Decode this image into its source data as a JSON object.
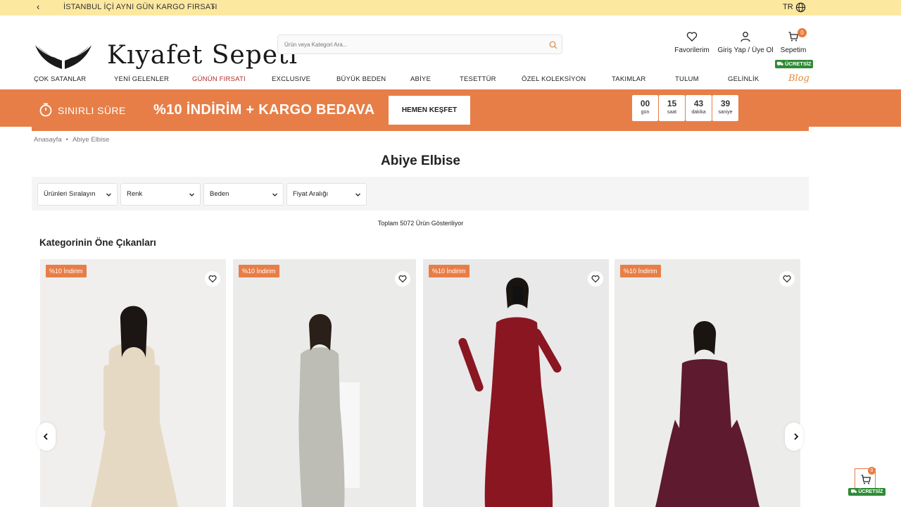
{
  "topbar": {
    "announcement": "İSTANBUL İÇİ AYNI GÜN KARGO FIRSATI",
    "prev": "‹",
    "next": "›",
    "lang": "TR"
  },
  "brand": {
    "name": "Kıyafet Sepeti"
  },
  "search": {
    "placeholder": "Ürün veya Kategori Ara..."
  },
  "header": {
    "favorites": "Favorilerim",
    "login": "Giriş Yap / Üye Ol",
    "cart": "Sepetim",
    "cart_count": "0",
    "free_shipping": "ÜCRETSİZ"
  },
  "nav": [
    "ÇOK SATANLAR",
    "YENİ GELENLER",
    "GÜNÜN FIRSATI",
    "EXCLUSIVE",
    "BÜYÜK BEDEN",
    "ABİYE",
    "TESETTÜR",
    "ÖZEL KOLEKSİYON",
    "TAKIMLAR",
    "TULUM",
    "GELİNLİK"
  ],
  "blog": "Blog",
  "promo": {
    "label": "SINIRLI SÜRE",
    "headline": "%10 İNDİRİM + KARGO BEDAVA",
    "button": "HEMEN KEŞFET",
    "countdown": [
      {
        "value": "00",
        "unit": "gün"
      },
      {
        "value": "15",
        "unit": "saat"
      },
      {
        "value": "43",
        "unit": "dakika"
      },
      {
        "value": "39",
        "unit": "saniye"
      }
    ]
  },
  "breadcrumb": {
    "home": "Anasayfa",
    "sep": "•",
    "current": "Abiye Elbise"
  },
  "page_title": "Abiye Elbise",
  "filters": [
    "Ürünleri Sıralayın",
    "Renk",
    "Beden",
    "Fiyat Aralığı"
  ],
  "total_text": "Toplam 5072 Ürün Gösteriliyor",
  "section_title": "Kategorinin Öne Çıkanları",
  "products": [
    {
      "badge": "%10 İndirim",
      "dress_color": "#e6d9c4",
      "bg": "#f0efed"
    },
    {
      "badge": "%10 İndirim",
      "dress_color": "#bdbcb5",
      "bg": "#ebebea"
    },
    {
      "badge": "%10 İndirim",
      "dress_color": "#8a1622",
      "bg": "#e9e9ea"
    },
    {
      "badge": "%10 İndirim",
      "dress_color": "#5e1a2e",
      "bg": "#ececeb"
    }
  ],
  "floating_cart": {
    "count": "0",
    "free": "ÜCRETSİZ"
  },
  "colors": {
    "accent": "#e77e47",
    "topbar": "#fde8a0",
    "free_badge": "#2e8b36",
    "hot": "#b02a2a",
    "blog": "#e08a3c"
  }
}
